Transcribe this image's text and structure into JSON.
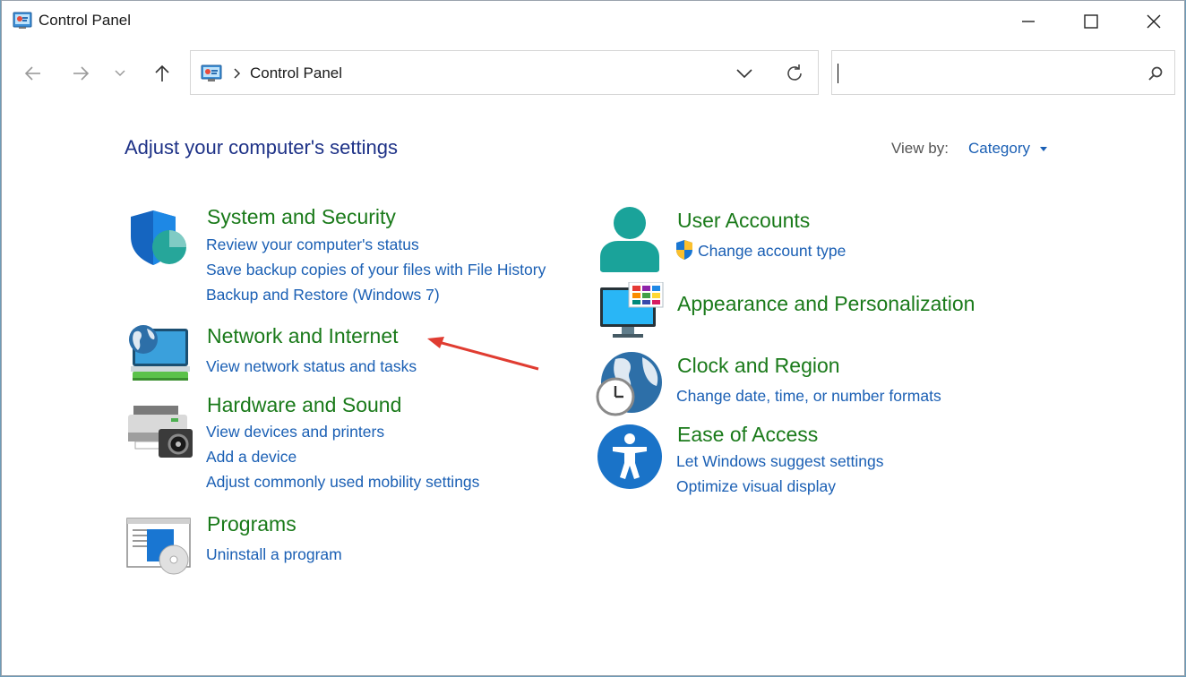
{
  "window": {
    "title": "Control Panel"
  },
  "address": {
    "path": "Control Panel"
  },
  "search": {
    "value": "",
    "placeholder": ""
  },
  "heading": "Adjust your computer's settings",
  "view_by": {
    "label": "View by:",
    "value": "Category"
  },
  "left_categories": [
    {
      "title": "System and Security",
      "icon": "shield-icon",
      "links": [
        "Review your computer's status",
        "Save backup copies of your files with File History",
        "Backup and Restore (Windows 7)"
      ]
    },
    {
      "title": "Network and Internet",
      "icon": "network-icon",
      "links": [
        "View network status and tasks"
      ]
    },
    {
      "title": "Hardware and Sound",
      "icon": "printer-icon",
      "links": [
        "View devices and printers",
        "Add a device",
        "Adjust commonly used mobility settings"
      ]
    },
    {
      "title": "Programs",
      "icon": "programs-icon",
      "links": [
        "Uninstall a program"
      ]
    }
  ],
  "right_categories": [
    {
      "title": "User Accounts",
      "icon": "user-icon",
      "links": [
        "Change account type"
      ]
    },
    {
      "title": "Appearance and Personalization",
      "icon": "monitor-icon",
      "links": []
    },
    {
      "title": "Clock and Region",
      "icon": "globe-clock-icon",
      "links": [
        "Change date, time, or number formats"
      ]
    },
    {
      "title": "Ease of Access",
      "icon": "accessibility-icon",
      "links": [
        "Let Windows suggest settings",
        "Optimize visual display"
      ]
    }
  ],
  "colors": {
    "heading": "#1e3287",
    "category_title": "#1a7a1a",
    "link": "#1a5fb4",
    "annotation_arrow": "#e03c31"
  }
}
